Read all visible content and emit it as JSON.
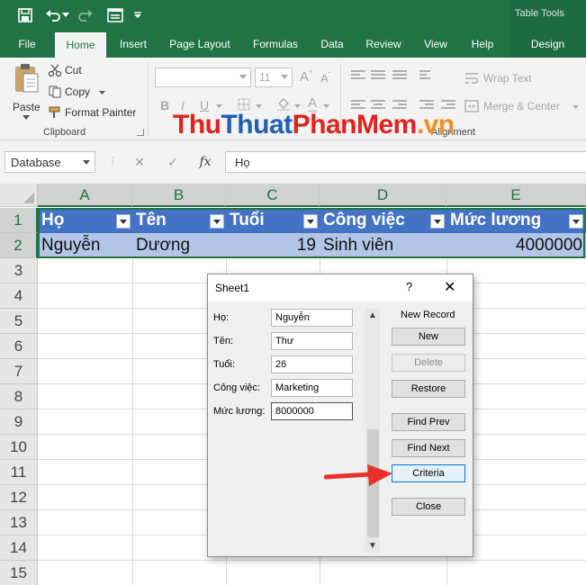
{
  "titlebar": {
    "context_tab": "Table Tools"
  },
  "tabs": [
    {
      "label": "File"
    },
    {
      "label": "Home"
    },
    {
      "label": "Insert"
    },
    {
      "label": "Page Layout"
    },
    {
      "label": "Formulas"
    },
    {
      "label": "Data"
    },
    {
      "label": "Review"
    },
    {
      "label": "View"
    },
    {
      "label": "Help"
    },
    {
      "label": "Design"
    }
  ],
  "ribbon": {
    "clipboard": {
      "paste": "Paste",
      "cut": "Cut",
      "copy": "Copy",
      "format_painter": "Format Painter",
      "group_label": "Clipboard"
    },
    "font": {
      "size": "11"
    },
    "alignment": {
      "wrap_text": "Wrap Text",
      "merge_center": "Merge & Center",
      "group_label": "Alignment"
    }
  },
  "watermark": {
    "part1": "Thu",
    "part2": "Thuat",
    "part3": "PhanMem",
    "part4": ".vn"
  },
  "formula_bar": {
    "name_box": "Database",
    "fx": "fx",
    "value": "Họ"
  },
  "sheet": {
    "columns": [
      "A",
      "B",
      "C",
      "D",
      "E"
    ],
    "rows": [
      "1",
      "2",
      "3",
      "4",
      "5",
      "6",
      "7",
      "8",
      "9",
      "10",
      "11",
      "12",
      "13",
      "14",
      "15"
    ],
    "headers": [
      "Họ",
      "Tên",
      "Tuổi",
      "Công việc",
      "Mức lương"
    ],
    "data_row": [
      "Nguyễn",
      "Dương",
      "19",
      "Sinh viên",
      "4000000"
    ]
  },
  "dialog": {
    "title": "Sheet1",
    "help": "?",
    "close": "✕",
    "fields": [
      {
        "label": "Họ:",
        "value": "Nguyễn"
      },
      {
        "label": "Tên:",
        "value": "Thư"
      },
      {
        "label": "Tuổi:",
        "value": "26"
      },
      {
        "label": "Công việc:",
        "value": "Marketing"
      },
      {
        "label": "Mức lương:",
        "value": "8000000"
      }
    ],
    "new_record": "New Record",
    "buttons": {
      "new": "New",
      "delete": "Delete",
      "restore": "Restore",
      "find_prev": "Find Prev",
      "find_next": "Find Next",
      "criteria": "Criteria",
      "close": "Close"
    }
  },
  "colors": {
    "excel_green": "#217346",
    "table_header": "#4472c4",
    "table_row": "#b4c6e7",
    "annotation_arrow": "#e8312a"
  }
}
